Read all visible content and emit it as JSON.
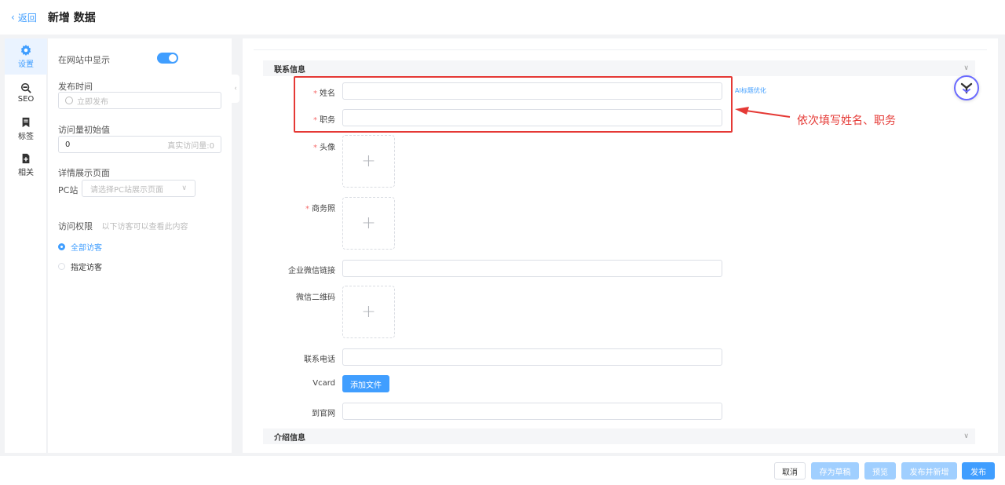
{
  "header": {
    "back_label": "返回",
    "title": "新增 数据"
  },
  "rail": {
    "items": [
      {
        "label": "设置",
        "active": true
      },
      {
        "label": "SEO"
      },
      {
        "label": "标签"
      },
      {
        "label": "相关"
      }
    ]
  },
  "settings": {
    "show_on_site_label": "在网站中显示",
    "show_on_site": true,
    "publish_time_label": "发布时间",
    "publish_time_placeholder": "立即发布",
    "visits_label": "访问量初始值",
    "visits_value": "0",
    "visits_suffix": "真实访问量:0",
    "detail_page_label": "详情展示页面",
    "pc_label": "PC站",
    "pc_placeholder": "请选择PC站展示页面",
    "access_label": "访问权限",
    "access_hint": "以下访客可以查看此内容",
    "access_options": [
      {
        "label": "全部访客",
        "checked": true
      },
      {
        "label": "指定访客",
        "checked": false
      }
    ]
  },
  "form": {
    "section_contact": "联系信息",
    "section_intro": "介绍信息",
    "name_label": "姓名",
    "title_label": "职务",
    "avatar_label": "头像",
    "business_photo_label": "商务照",
    "wechat_link_label": "企业微信链接",
    "wechat_qr_label": "微信二维码",
    "phone_label": "联系电话",
    "vcard_label": "Vcard",
    "add_file_label": "添加文件",
    "website_label": "到官网",
    "ai_link": "AI标题优化",
    "required_mark": "*",
    "plus": "+"
  },
  "annotation": {
    "text": "依次填写姓名、职务",
    "color": "#e53935"
  },
  "actions": {
    "cancel": "取消",
    "save_draft": "存为草稿",
    "preview": "预览",
    "publish_new": "发布并新增",
    "publish": "发布"
  },
  "colors": {
    "primary": "#409eff",
    "primary_light": "#a0cfff",
    "required": "#f56c6c"
  }
}
